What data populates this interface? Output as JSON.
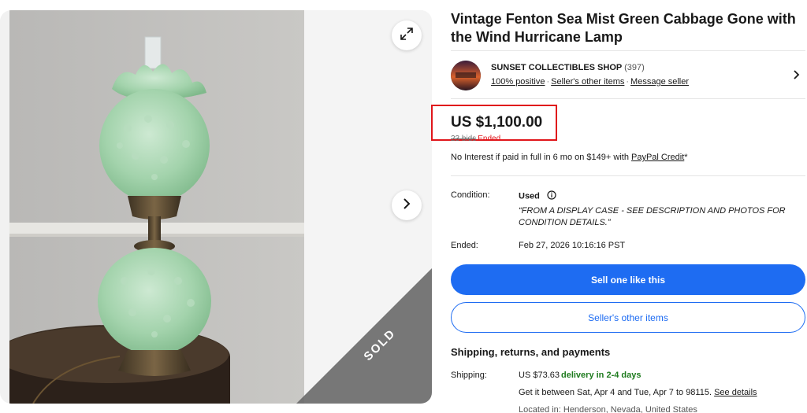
{
  "gallery": {
    "sold_label": "SOLD"
  },
  "listing": {
    "title": "Vintage Fenton Sea Mist Green Cabbage Gone with the Wind Hurricane Lamp"
  },
  "seller": {
    "name": "SUNSET COLLECTIBLES SHOP",
    "feedback_count": "(397)",
    "positive": "100% positive",
    "other_items_link": "Seller's other items",
    "message_link": "Message seller",
    "logo_text": "SUNSET COLLECTIBLES SHOP"
  },
  "price": {
    "amount": "US $1,100.00",
    "bids": "23 bids",
    "status": "Ended",
    "highlight_color": "#e0161b"
  },
  "credit": {
    "text": "No Interest if paid in full in 6 mo on $149+ with",
    "link": "PayPal Credit",
    "suffix": "*"
  },
  "condition": {
    "label": "Condition:",
    "value": "Used",
    "description": "“FROM A DISPLAY CASE - SEE DESCRIPTION AND PHOTOS FOR CONDITION DETAILS.”"
  },
  "ended": {
    "label": "Ended:",
    "value": "Feb 27, 2026 10:16:16 PST"
  },
  "buttons": {
    "sell_one": "Sell one like this",
    "sellers_other_items": "Seller's other items",
    "primary_color": "#1e6cf2"
  },
  "shipping": {
    "heading": "Shipping, returns, and payments",
    "label": "Shipping:",
    "cost": "US $73.63",
    "delivery": "delivery in 2-4 days",
    "estimate": "Get it between Sat, Apr 4 and Tue, Apr 7 to 98115.",
    "see_details": "See details",
    "location": "Located in: Henderson, Nevada, United States"
  },
  "icons": [
    "expand-icon",
    "chevron-right-icon",
    "info-icon",
    "seller-chevron-icon"
  ]
}
